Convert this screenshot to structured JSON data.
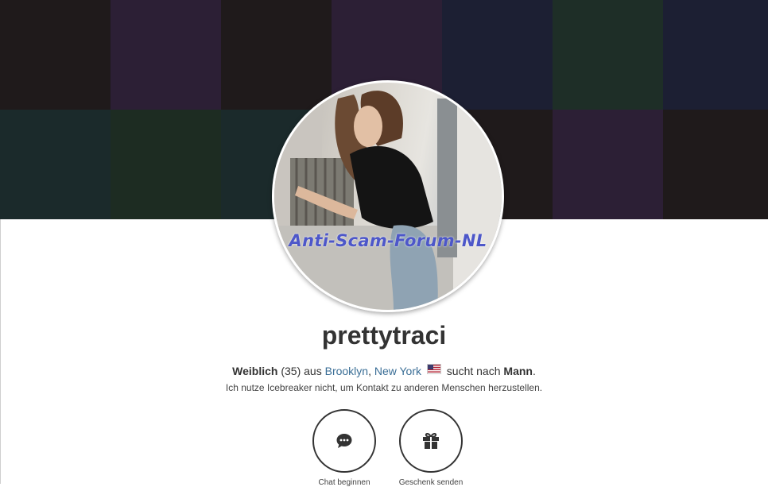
{
  "cover": {
    "tiles": [
      "#1f1a1b",
      "#2c1f35",
      "#1f1a1b",
      "#2c1f35",
      "#1c1f33",
      "#1e2e27",
      "#1c1f33",
      "#1b2a2b",
      "#1d2c22",
      "#1b2a2b",
      "#1f1a1b",
      "#1f1a1b",
      "#2c1f35",
      "#1f1a1b"
    ]
  },
  "profile": {
    "avatar_watermark": "Anti-Scam-Forum-NL",
    "username": "prettytraci",
    "gender": "Weiblich",
    "age": "(35)",
    "aus": "aus",
    "city": "Brooklyn",
    "state": "New York",
    "flag_icon": "us-flag-icon",
    "seeking_text": "sucht nach",
    "seeking": "Mann",
    "note": "Ich nutze Icebreaker nicht, um Kontakt zu anderen Menschen herzustellen."
  },
  "actions": {
    "chat": {
      "label": "Chat beginnen",
      "icon": "chat-bubble-icon"
    },
    "gift": {
      "label": "Geschenk senden",
      "icon": "gift-icon"
    }
  },
  "colors": {
    "link": "#3a6e96",
    "watermark": "#4d57c9",
    "text": "#333333"
  }
}
